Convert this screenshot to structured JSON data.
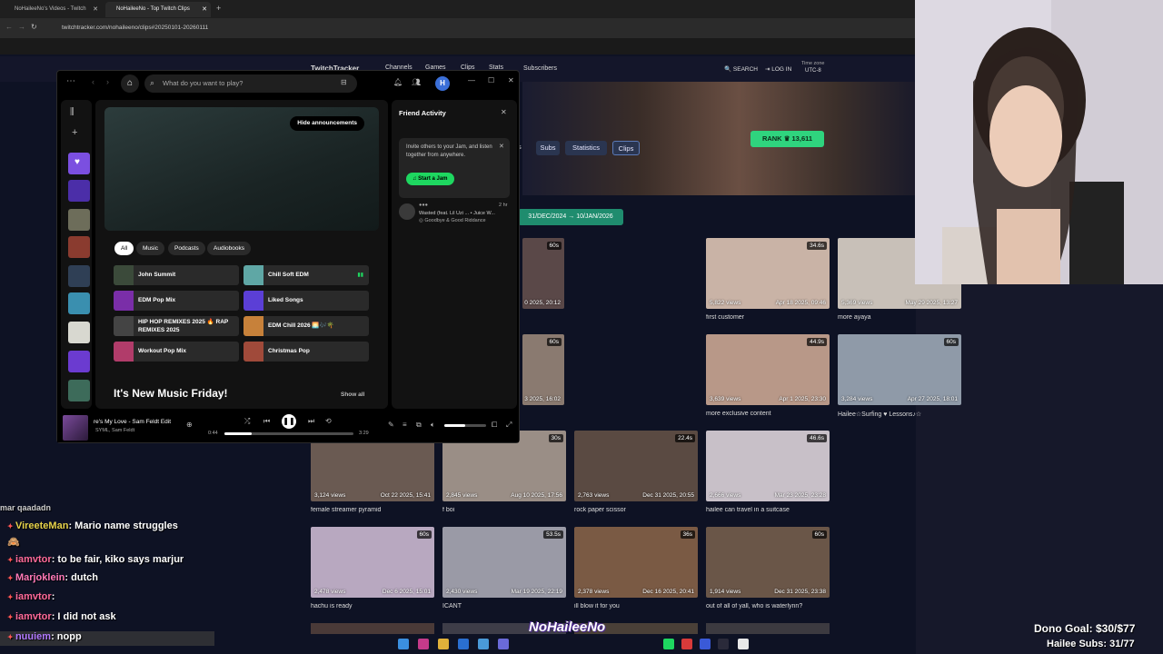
{
  "browser": {
    "tabs": [
      {
        "label": "NoHaileeNo's Videos - Twitch"
      },
      {
        "label": "NoHaileeNo - Top Twitch Clips"
      }
    ],
    "address": "twitchtracker.com/nohaileeno/clips#20250101-20260111"
  },
  "site": {
    "brand": "TwitchTracker",
    "nav": [
      "Channels",
      "Games",
      "Clips",
      "Stats",
      "Subscribers"
    ],
    "search_label": "SEARCH",
    "login_label": "LOG IN",
    "timezone_label": "Time zone",
    "timezone_value": "UTC-8",
    "rank_label": "RANK",
    "rank_value": "13,611",
    "tabs": [
      "s",
      "Subs",
      "Statistics",
      "Clips"
    ],
    "date_range": "31/DEC/2024 → 10/JAN/2026",
    "clips": [
      {
        "dur": "60s",
        "views": "",
        "date": "0 2025, 20:12",
        "title": ""
      },
      {
        "dur": "34.6s",
        "views": "5,822 views",
        "date": "Apr 18 2025, 09:46",
        "title": "first customer"
      },
      {
        "dur": "60s",
        "views": "5,369 views",
        "date": "May 29 2025, 13:27",
        "title": "more ayaya"
      },
      {
        "dur": "60s",
        "views": "",
        "date": "3 2025, 16:02",
        "title": ""
      },
      {
        "dur": "44.9s",
        "views": "3,639 views",
        "date": "Apr 1 2025, 23:30",
        "title": "more exclusive content"
      },
      {
        "dur": "60s",
        "views": "3,284 views",
        "date": "Apr 27 2025, 18:01",
        "title": "Hailee☆Surfing ♥ Lessons♪☆"
      },
      {
        "dur": "",
        "views": "3,124 views",
        "date": "Oct 22 2025, 15:41",
        "title": "female streamer pyramid"
      },
      {
        "dur": "30s",
        "views": "2,845 views",
        "date": "Aug 10 2025, 17:56",
        "title": "f boi"
      },
      {
        "dur": "22.4s",
        "views": "2,763 views",
        "date": "Dec 31 2025, 20:55",
        "title": "rock paper scissor"
      },
      {
        "dur": "46.6s",
        "views": "2,666 views",
        "date": "Mar 23 2025, 23:28",
        "title": "hailee can travel in a suitcase"
      },
      {
        "dur": "60s",
        "views": "2,478 views",
        "date": "Dec 6 2025, 15:01",
        "title": "hachu is ready"
      },
      {
        "dur": "53.5s",
        "views": "2,430 views",
        "date": "Mar 19 2025, 22:19",
        "title": "ICANT"
      },
      {
        "dur": "36s",
        "views": "2,378 views",
        "date": "Dec 16 2025, 20:41",
        "title": "ill blow it for you"
      },
      {
        "dur": "60s",
        "views": "1,914 views",
        "date": "Dec 31 2025, 23:38",
        "title": "out of all of yall, who is waterlynn?"
      }
    ],
    "partial_durs": [
      "15.5s",
      "",
      "10s",
      "17s"
    ]
  },
  "spotify": {
    "search_placeholder": "What do you want to play?",
    "avatar": "H",
    "hide_announcements": "Hide announcements",
    "filters": [
      "All",
      "Music",
      "Podcasts",
      "Audiobooks"
    ],
    "quick": [
      {
        "label": "John Summit",
        "color": "#3b4a3a"
      },
      {
        "label": "Chill Soft EDM",
        "color": "#5fa7a5"
      },
      {
        "label": "EDM Pop Mix",
        "color": "#7a2ea8"
      },
      {
        "label": "Liked Songs",
        "color": "#5b3fd6"
      },
      {
        "label": "HIP HOP REMIXES 2025 🔥 RAP REMIXES 2025",
        "color": "#444"
      },
      {
        "label": "EDM Chill 2026 🌅🎶🌴",
        "color": "#c7813a"
      },
      {
        "label": "Workout Pop Mix",
        "color": "#b13c6a"
      },
      {
        "label": "Christmas Pop",
        "color": "#a04a3a"
      }
    ],
    "section_title": "It's New Music Friday!",
    "show_all": "Show all",
    "friend": {
      "title": "Friend Activity",
      "jam_text": "Invite others to your Jam, and listen together from anywhere.",
      "jam_button": "Start a Jam",
      "activity_time": "2 hr",
      "activity_track": "Wasted (feat. Lil Uzi ... • Juice W...",
      "activity_album": "Goodbye & Good Riddance"
    },
    "now_playing": {
      "title": "re's My Love - Sam Feldt Edit",
      "artist": "SYML, Sam Feldt",
      "elapsed": "0:44",
      "duration": "3:29",
      "progress": 0.21,
      "volume": 0.5
    }
  },
  "chat": [
    {
      "user": "",
      "text": "mar qaadadn",
      "color": "#ccc"
    },
    {
      "user": "VireeteMan",
      "text": ": Mario name struggles",
      "color": "#e6d24a"
    },
    {
      "user": "",
      "text": "🙈",
      "color": "#fff"
    },
    {
      "user": "iamvtor",
      "text": ": to be fair, kiko says marjur",
      "color": "#ff6a9a"
    },
    {
      "user": "Marjoklein",
      "text": ": dutch",
      "color": "#ff7ab8"
    },
    {
      "user": "iamvtor",
      "text": ":",
      "color": "#ff6a9a"
    },
    {
      "user": "iamvtor",
      "text": ": I did not ask",
      "color": "#ff6a9a"
    },
    {
      "user": "nuuiem",
      "text": ": nopp",
      "color": "#b27aff"
    }
  ],
  "overlay": {
    "streamer_tag": "NoHaileeNo",
    "dono_goal": "Dono Goal: $30/$77",
    "subs_goal": "Hailee Subs: 31/77"
  }
}
